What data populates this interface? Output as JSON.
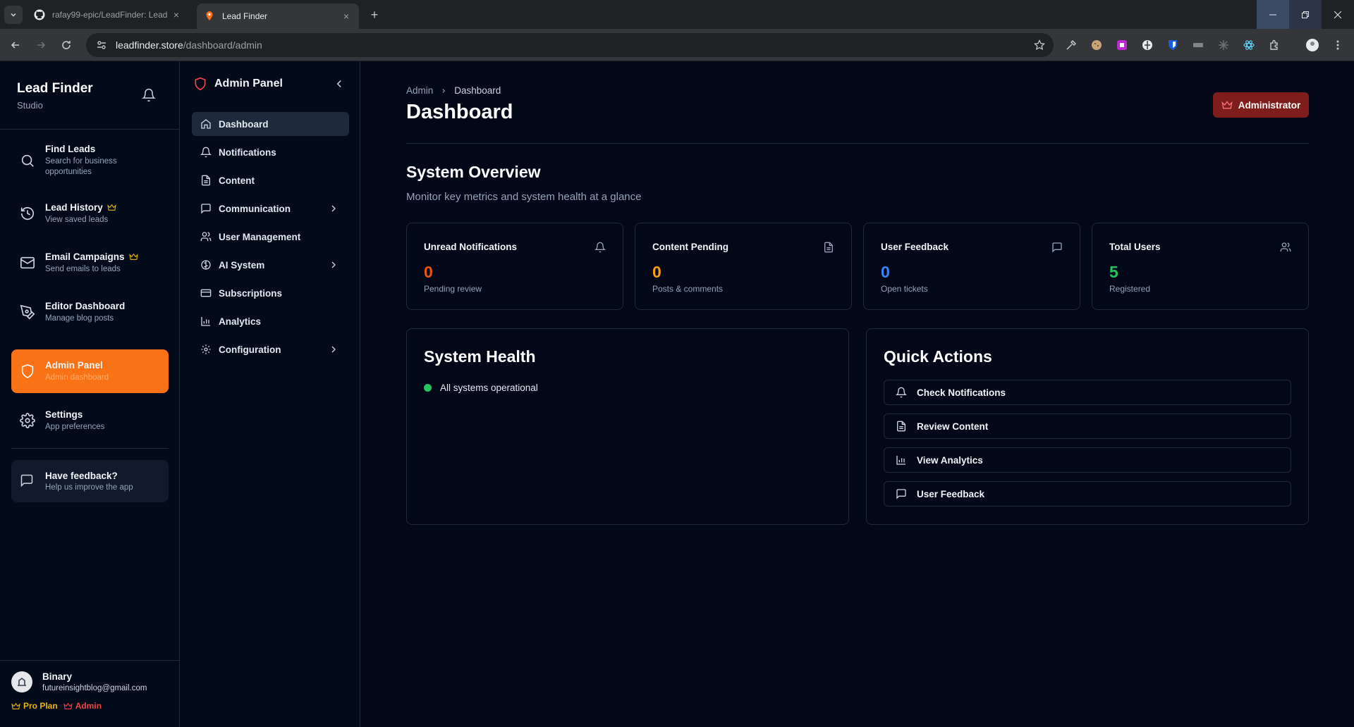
{
  "browser": {
    "tabs": [
      {
        "title": "rafay99-epic/LeadFinder: Lead",
        "icon": "github-icon"
      },
      {
        "title": "Lead Finder",
        "icon": "pin-icon"
      }
    ],
    "url_host": "leadfinder.store",
    "url_path": "/dashboard/admin"
  },
  "sidebar": {
    "brand_name": "Lead Finder",
    "brand_sub": "Studio",
    "items": [
      {
        "title": "Find Leads",
        "sub": "Search for business opportunities",
        "icon": "search-icon"
      },
      {
        "title": "Lead History",
        "sub": "View saved leads",
        "icon": "history-icon",
        "premium": true
      },
      {
        "title": "Email Campaigns",
        "sub": "Send emails to leads",
        "icon": "mail-icon",
        "premium": true
      },
      {
        "title": "Editor Dashboard",
        "sub": "Manage blog posts",
        "icon": "pen-icon"
      },
      {
        "title": "Admin Panel",
        "sub": "Admin dashboard",
        "icon": "shield-icon",
        "active": true
      },
      {
        "title": "Settings",
        "sub": "App preferences",
        "icon": "gear-icon"
      }
    ],
    "feedback": {
      "title": "Have feedback?",
      "sub": "Help us improve the app"
    },
    "user": {
      "name": "Binary",
      "email": "futureinsightblog@gmail.com",
      "plan_badge": "Pro Plan",
      "role_badge": "Admin"
    }
  },
  "subnav": {
    "title": "Admin Panel",
    "items": [
      {
        "label": "Dashboard",
        "icon": "home-icon",
        "active": true
      },
      {
        "label": "Notifications",
        "icon": "bell-icon"
      },
      {
        "label": "Content",
        "icon": "file-icon"
      },
      {
        "label": "Communication",
        "icon": "message-icon",
        "expandable": true
      },
      {
        "label": "User Management",
        "icon": "users-icon"
      },
      {
        "label": "AI System",
        "icon": "brain-icon",
        "expandable": true
      },
      {
        "label": "Subscriptions",
        "icon": "card-icon"
      },
      {
        "label": "Analytics",
        "icon": "chart-icon"
      },
      {
        "label": "Configuration",
        "icon": "gear-icon",
        "expandable": true
      }
    ]
  },
  "main": {
    "breadcrumb": [
      "Admin",
      "Dashboard"
    ],
    "title": "Dashboard",
    "role_button": "Administrator",
    "overview_title": "System Overview",
    "overview_sub": "Monitor key metrics and system health at a glance",
    "stats": [
      {
        "label": "Unread Notifications",
        "value": "0",
        "sub": "Pending review",
        "color": "#ea580c",
        "icon": "bell-icon"
      },
      {
        "label": "Content Pending",
        "value": "0",
        "sub": "Posts & comments",
        "color": "#f59e0b",
        "icon": "file-icon"
      },
      {
        "label": "User Feedback",
        "value": "0",
        "sub": "Open tickets",
        "color": "#3b82f6",
        "icon": "message-icon"
      },
      {
        "label": "Total Users",
        "value": "5",
        "sub": "Registered",
        "color": "#22c55e",
        "icon": "users-icon"
      }
    ],
    "health_title": "System Health",
    "health_status": "All systems operational",
    "quick_title": "Quick Actions",
    "quick_actions": [
      {
        "label": "Check Notifications",
        "icon": "bell-icon"
      },
      {
        "label": "Review Content",
        "icon": "file-icon"
      },
      {
        "label": "View Analytics",
        "icon": "chart-icon"
      },
      {
        "label": "User Feedback",
        "icon": "message-icon"
      }
    ]
  },
  "colors": {
    "accent": "#f97316",
    "danger": "#ef4444",
    "success": "#22c55e"
  }
}
